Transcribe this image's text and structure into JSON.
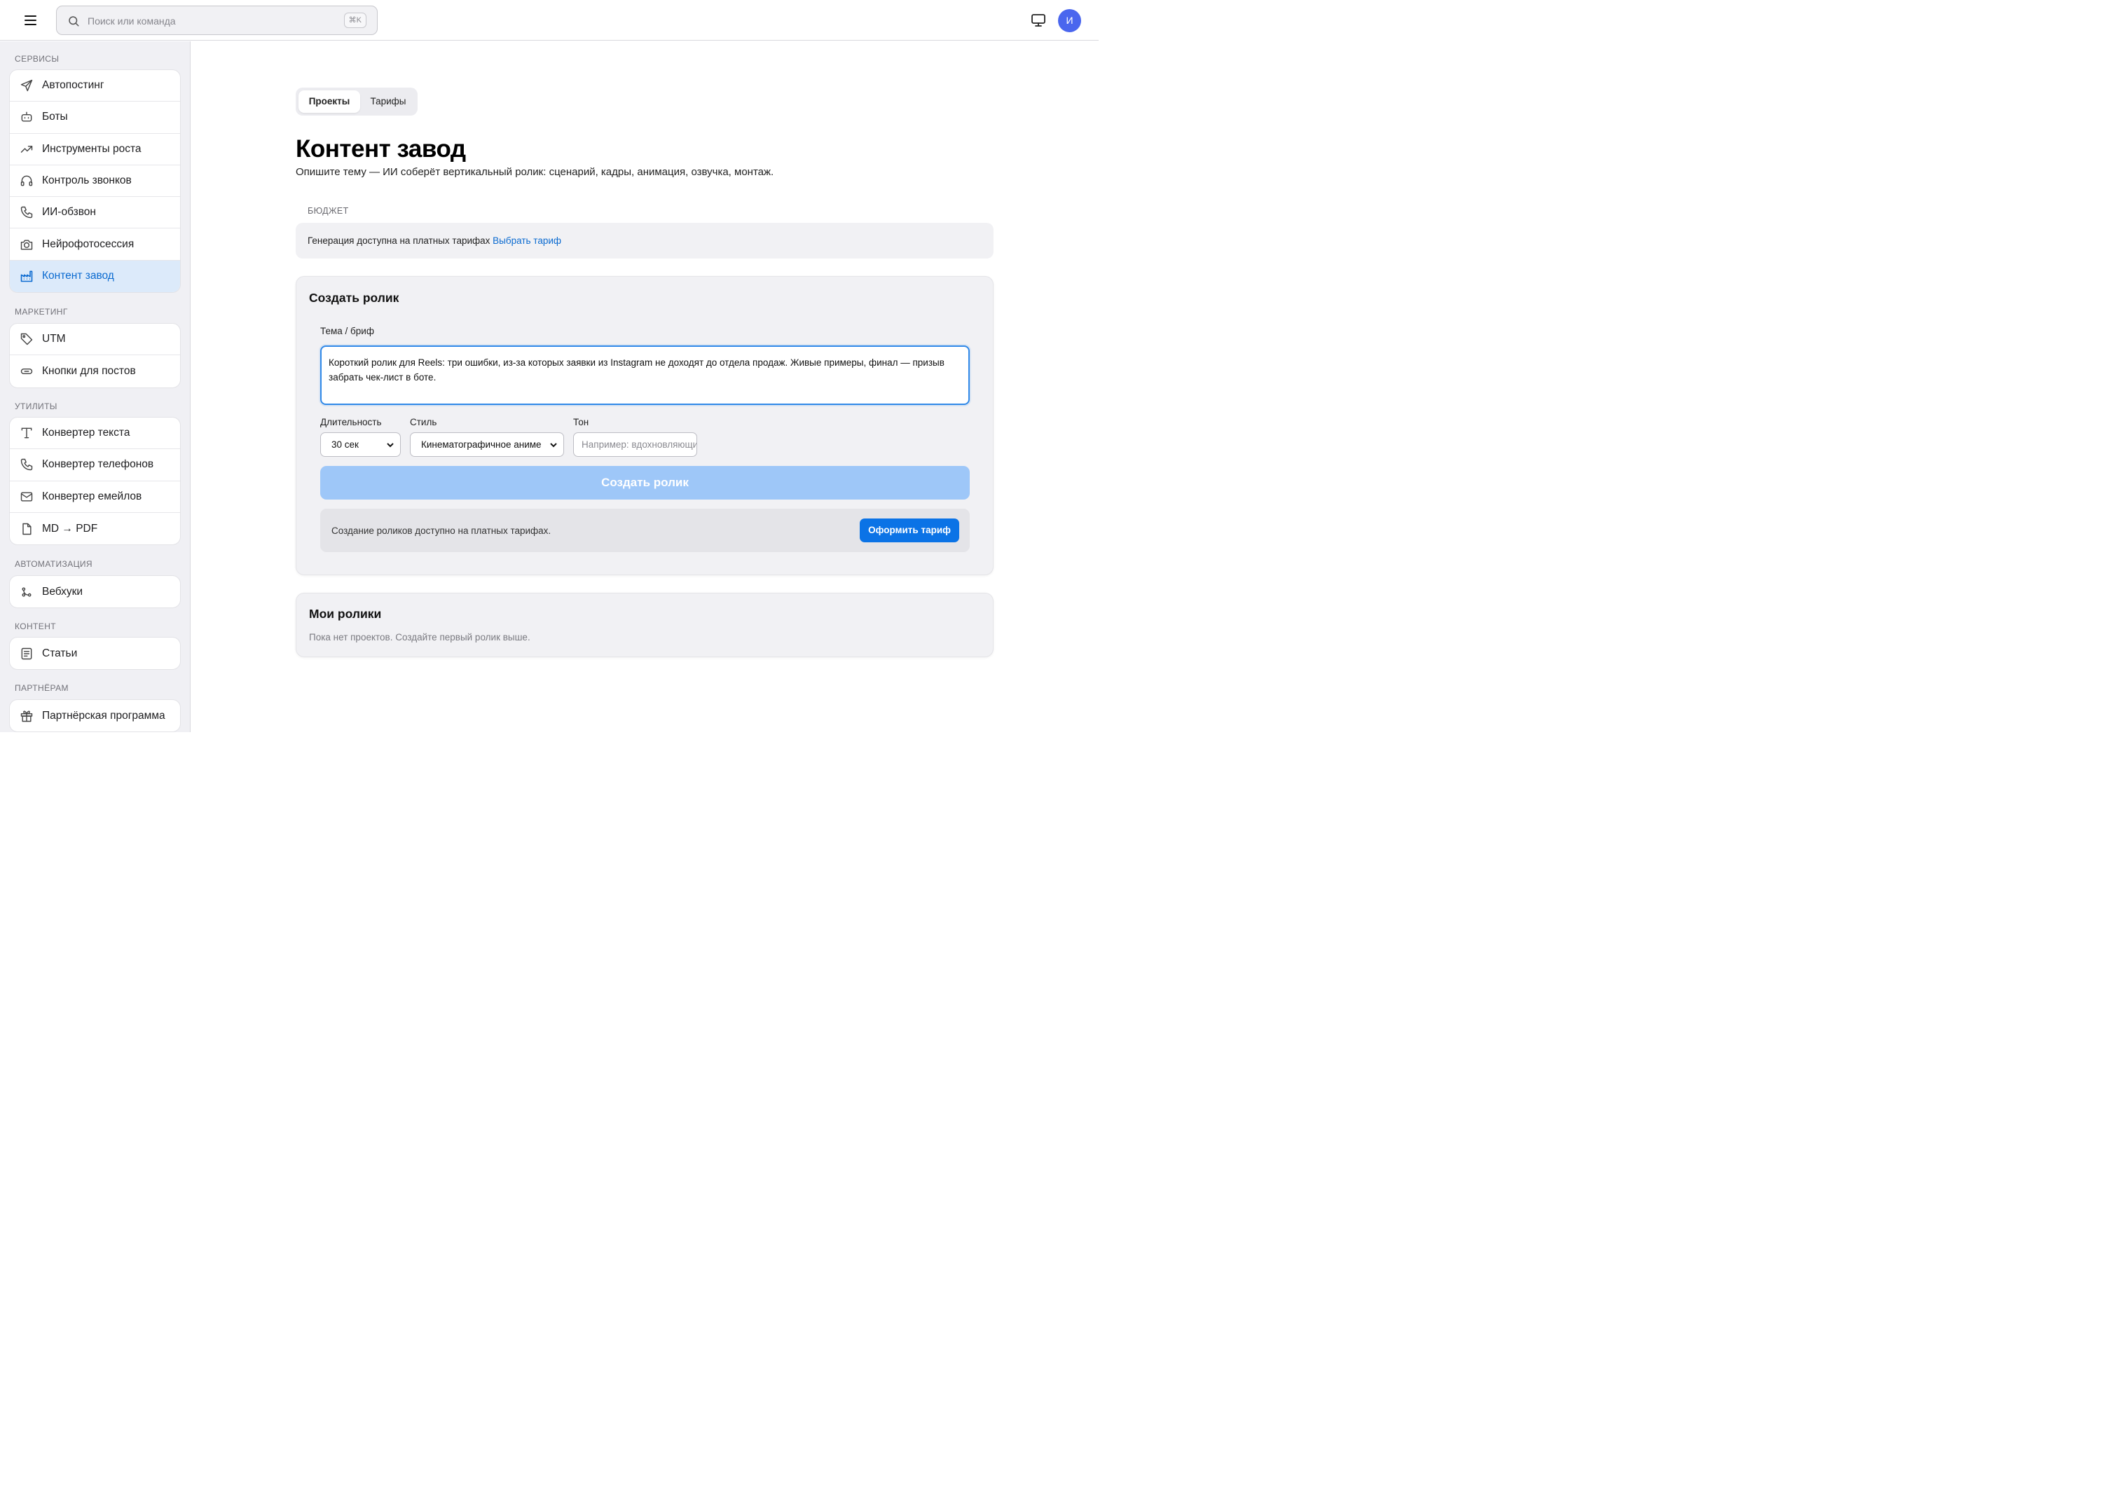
{
  "topbar": {
    "search_placeholder": "Поиск или команда",
    "shortcut": "⌘K",
    "avatar_letter": "И"
  },
  "sidebar": {
    "sections": [
      {
        "title": "СЕРВИСЫ",
        "items": [
          {
            "label": "Автопостинг",
            "icon": "send-icon"
          },
          {
            "label": "Боты",
            "icon": "bot-icon"
          },
          {
            "label": "Инструменты роста",
            "icon": "trending-up-icon"
          },
          {
            "label": "Контроль звонков",
            "icon": "headphones-icon"
          },
          {
            "label": "ИИ-обзвон",
            "icon": "phone-icon"
          },
          {
            "label": "Нейрофотосессия",
            "icon": "camera-icon"
          },
          {
            "label": "Контент завод",
            "icon": "factory-icon",
            "active": true
          }
        ]
      },
      {
        "title": "МАРКЕТИНГ",
        "items": [
          {
            "label": "UTM",
            "icon": "tag-icon"
          },
          {
            "label": "Кнопки для постов",
            "icon": "button-icon"
          }
        ]
      },
      {
        "title": "УТИЛИТЫ",
        "items": [
          {
            "label": "Конвертер текста",
            "icon": "text-icon"
          },
          {
            "label": "Конвертер телефонов",
            "icon": "phone-icon"
          },
          {
            "label": "Конвертер емейлов",
            "icon": "mail-icon"
          },
          {
            "label": "MD → PDF",
            "icon": "file-icon"
          }
        ]
      },
      {
        "title": "АВТОМАТИЗАЦИЯ",
        "items": [
          {
            "label": "Вебхуки",
            "icon": "webhook-icon"
          }
        ]
      },
      {
        "title": "КОНТЕНТ",
        "items": [
          {
            "label": "Статьи",
            "icon": "article-icon"
          }
        ]
      },
      {
        "title": "ПАРТНЁРАМ",
        "items": [
          {
            "label": "Партнёрская программа",
            "icon": "gift-icon"
          }
        ]
      }
    ]
  },
  "main": {
    "tabs": [
      {
        "label": "Проекты",
        "active": true
      },
      {
        "label": "Тарифы"
      }
    ],
    "title": "Контент завод",
    "subtitle": "Опишите тему — ИИ соберёт вертикальный ролик: сценарий, кадры, анимация, озвучка, монтаж.",
    "budget": {
      "label": "БЮДЖЕТ",
      "text": "Генерация доступна на платных тарифах",
      "link": "Выбрать тариф"
    },
    "create": {
      "title": "Создать ролик",
      "brief_label": "Тема / бриф",
      "brief_value": "Короткий ролик для Reels: три ошибки, из-за которых заявки из Instagram не доходят до отдела продаж. Живые примеры, финал — призыв забрать чек-лист в боте.",
      "duration_label": "Длительность",
      "duration_value": "30 сек",
      "style_label": "Стиль",
      "style_value": "Кинематографичное аниме",
      "tone_label": "Тон",
      "tone_placeholder": "Например: вдохновляющий",
      "button": "Создать ролик",
      "paywall_text": "Создание роликов доступно на платных тарифах.",
      "paywall_button": "Оформить тариф"
    },
    "mine": {
      "title": "Мои ролики",
      "empty": "Пока нет проектов. Создайте первый ролик выше."
    }
  },
  "colors": {
    "accent": "#0b73e6",
    "active_bg": "#dceafa",
    "avatar": "#4a66ee"
  }
}
